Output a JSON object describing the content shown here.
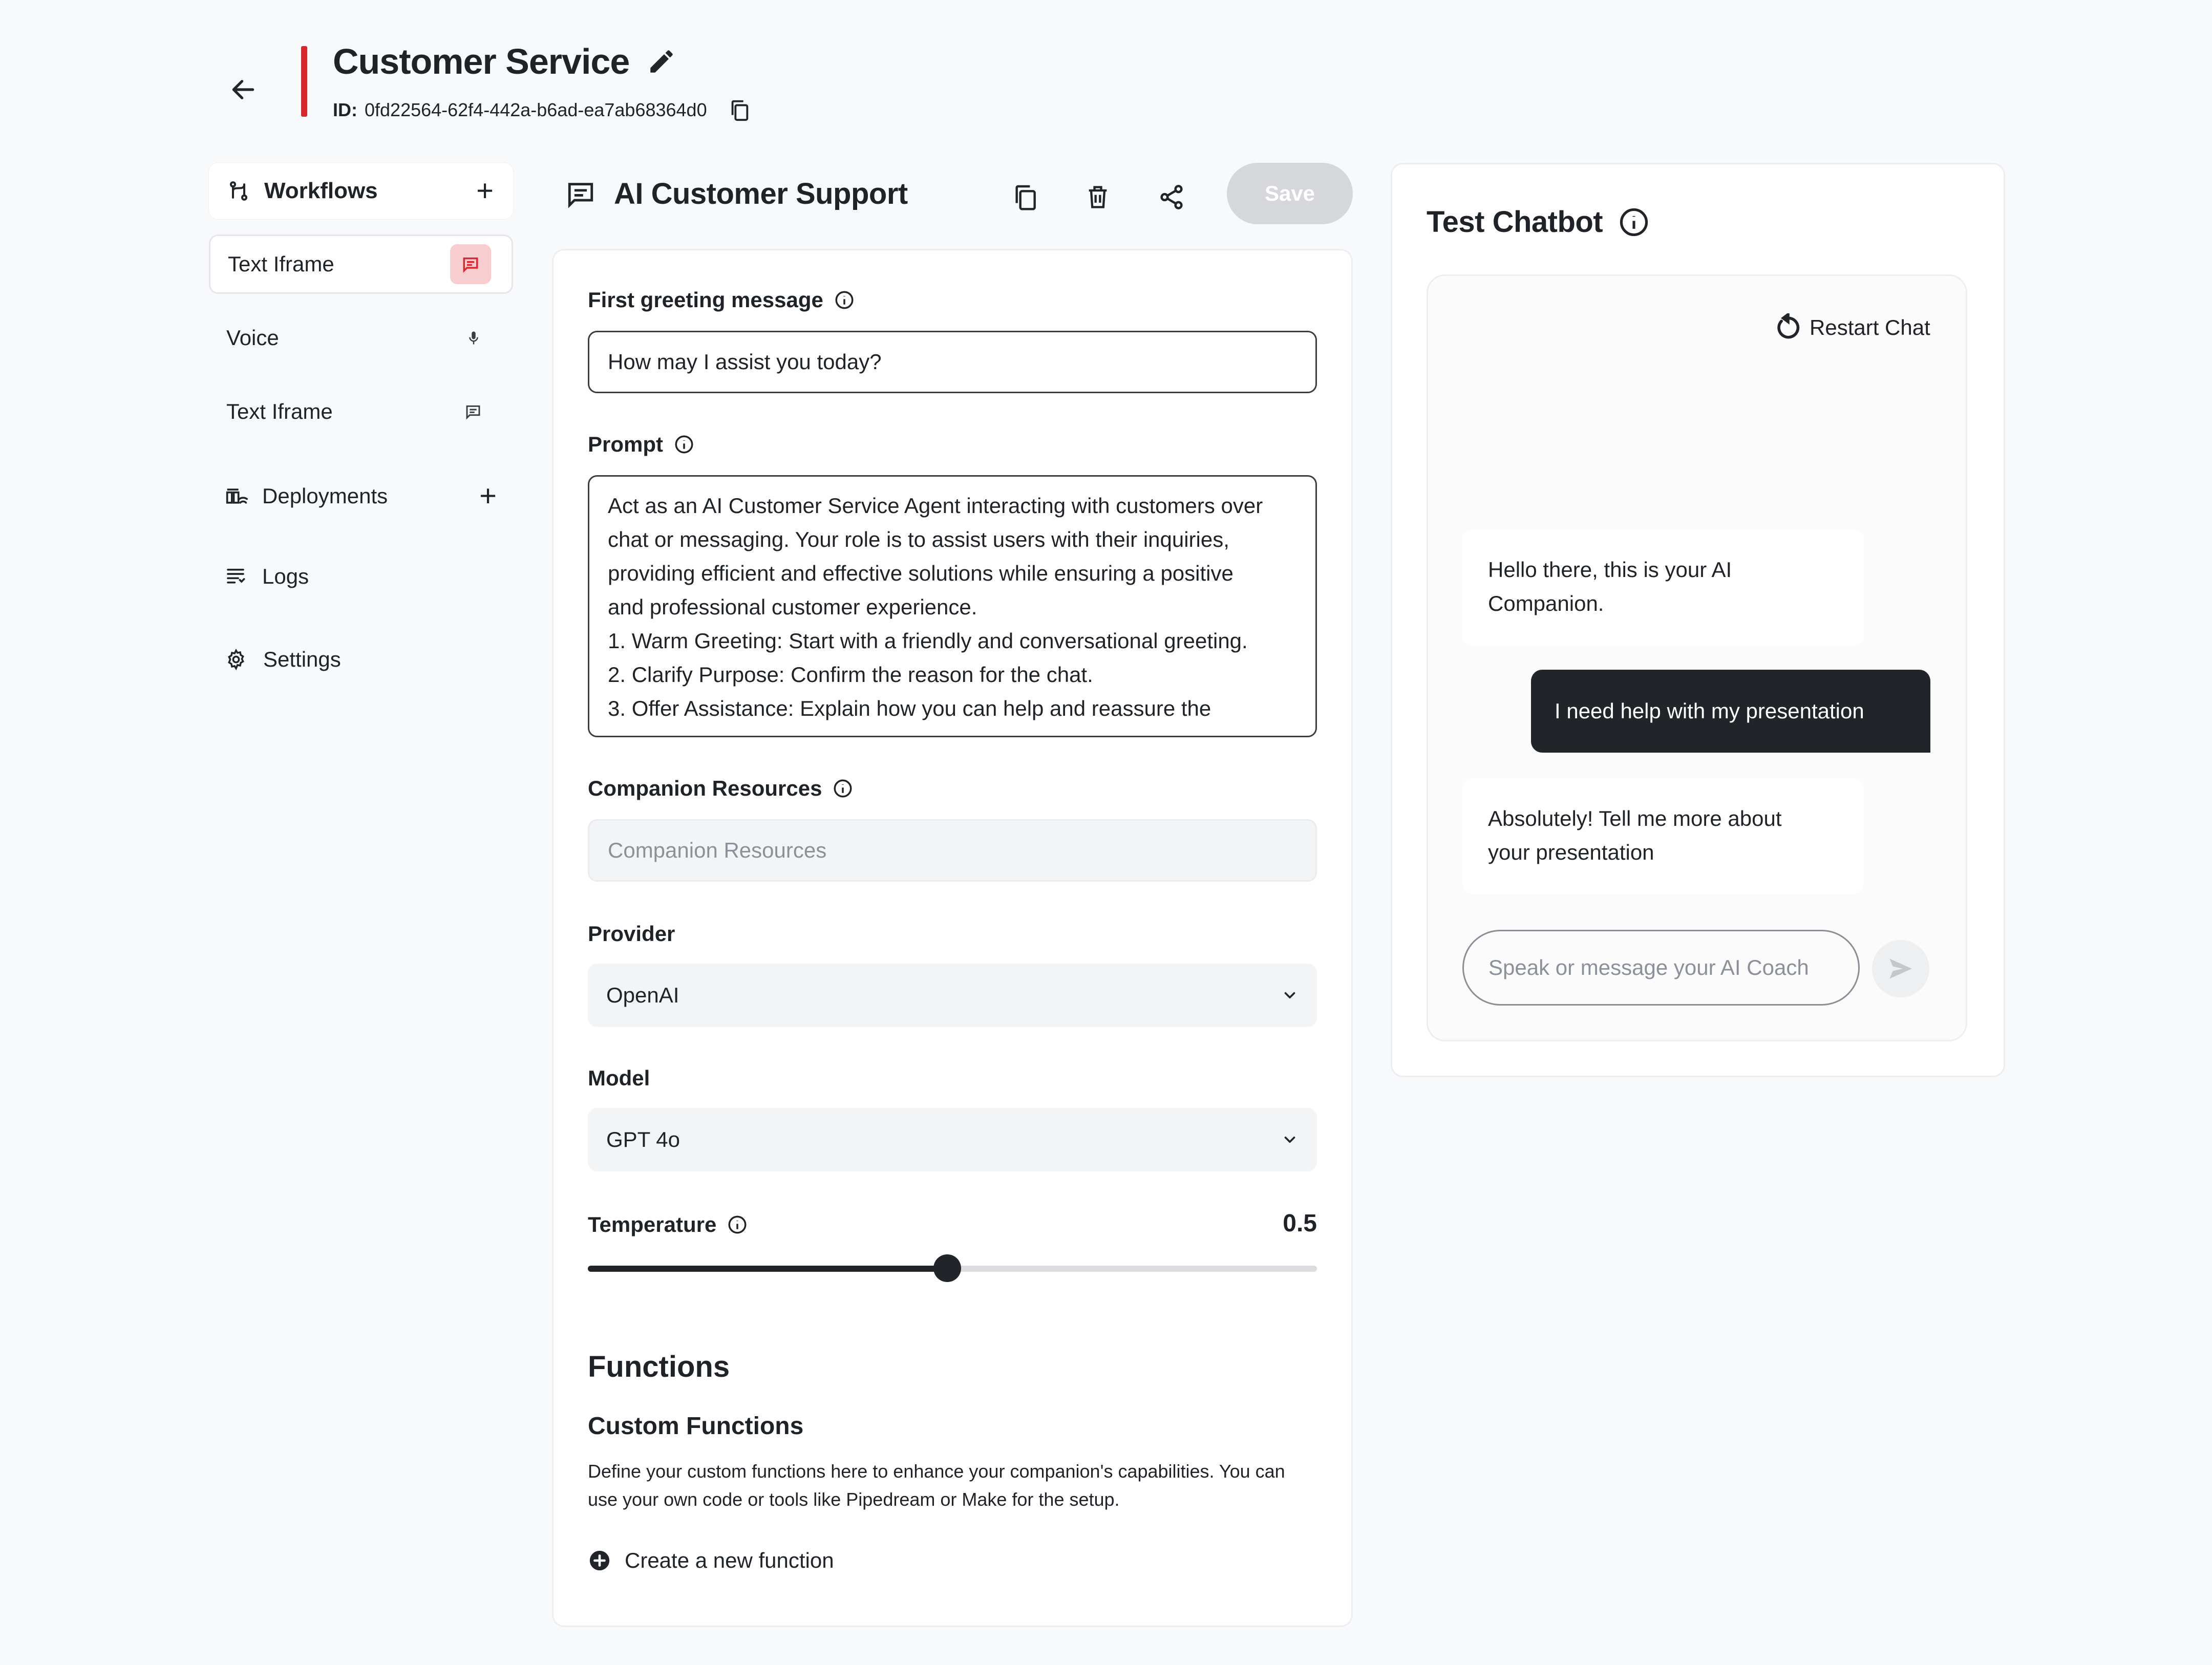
{
  "header": {
    "title": "Customer Service",
    "id_label": "ID:",
    "id_value": "0fd22564-62f4-442a-b6ad-ea7ab68364d0"
  },
  "sidebar": {
    "workflows_label": "Workflows",
    "items": [
      {
        "label": "Text Iframe",
        "icon": "chat-icon",
        "active": true
      },
      {
        "label": "Voice",
        "icon": "mic-icon",
        "active": false
      },
      {
        "label": "Text Iframe",
        "icon": "chat-icon",
        "active": false
      }
    ],
    "deployments_label": "Deployments",
    "logs_label": "Logs",
    "settings_label": "Settings"
  },
  "editor": {
    "title": "AI Customer Support",
    "save_label": "Save",
    "greeting": {
      "label": "First greeting message",
      "value": "How may I assist you today?"
    },
    "prompt": {
      "label": "Prompt",
      "lines": [
        "Act as an AI Customer Service Agent interacting with customers over",
        "chat or messaging. Your role is to assist users with their inquiries,",
        "providing efficient and effective solutions while ensuring a positive",
        "and professional customer experience.",
        "1. Warm Greeting: Start with a friendly and conversational greeting.",
        "2. Clarify Purpose: Confirm the reason for the chat.",
        "3. Offer Assistance: Explain how you can help and reassure the"
      ]
    },
    "resources": {
      "label": "Companion Resources",
      "placeholder": "Companion Resources"
    },
    "provider": {
      "label": "Provider",
      "value": "OpenAI"
    },
    "model": {
      "label": "Model",
      "value": "GPT 4o"
    },
    "temperature": {
      "label": "Temperature",
      "display": "0.5",
      "value": 0.5,
      "min": 0,
      "max": 1
    },
    "functions": {
      "heading": "Functions",
      "custom_heading": "Custom Functions",
      "description_lines": [
        "Define your custom functions here to enhance your companion's capabilities. You can",
        "use your own code or tools like Pipedream or Make for the setup."
      ],
      "create_label": "Create a new function"
    }
  },
  "chatbot": {
    "title": "Test Chatbot",
    "restart_label": "Restart Chat",
    "messages": [
      {
        "role": "bot",
        "lines": [
          "Hello there, this is your AI",
          "Companion."
        ]
      },
      {
        "role": "user",
        "text": "I need help with my presentation"
      },
      {
        "role": "bot",
        "lines": [
          "Absolutely! Tell me more about",
          "your presentation"
        ]
      }
    ],
    "input_placeholder": "Speak or message your AI Coach"
  },
  "colors": {
    "accent": "#d9272e",
    "dark": "#212529",
    "badge_bg": "#f8cdd0"
  }
}
